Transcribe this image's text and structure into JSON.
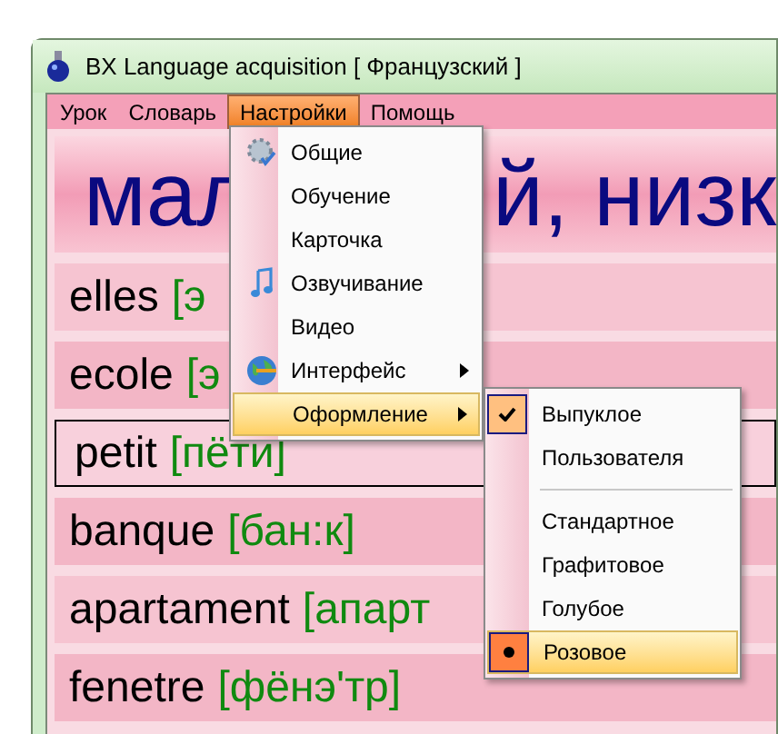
{
  "window": {
    "title": "BX Language acquisition [ Французский ]"
  },
  "menu_bar": [
    {
      "label": "Урок",
      "selected": false
    },
    {
      "label": "Словарь",
      "selected": false
    },
    {
      "label": "Настройки",
      "selected": true
    },
    {
      "label": "Помощь",
      "selected": false
    }
  ],
  "header": {
    "left": "мал",
    "right": "й, низк"
  },
  "words": [
    {
      "word": "elles",
      "transcription": "[э",
      "selected": false
    },
    {
      "word": "ecole",
      "transcription": "[э",
      "selected": false
    },
    {
      "word": "petit",
      "transcription": "[пёти]",
      "selected": true
    },
    {
      "word": "banque",
      "transcription": "[бан:к]",
      "selected": false
    },
    {
      "word": "apartament",
      "transcription": "[апарт",
      "selected": false
    },
    {
      "word": "fenetre",
      "transcription": "[фёнэ'тр]",
      "selected": false
    }
  ],
  "settings_menu": [
    {
      "label": "Общие",
      "kind": "gear",
      "submenu": false,
      "selected": false
    },
    {
      "label": "Обучение",
      "kind": "plain",
      "submenu": false,
      "selected": false
    },
    {
      "label": "Карточка",
      "kind": "plain",
      "submenu": false,
      "selected": false
    },
    {
      "label": "Озвучивание",
      "kind": "note",
      "submenu": false,
      "selected": false
    },
    {
      "label": "Видео",
      "kind": "plain",
      "submenu": false,
      "selected": false
    },
    {
      "label": "Интерфейс",
      "kind": "globe",
      "submenu": true,
      "selected": false
    },
    {
      "label": "Оформление",
      "kind": "plain",
      "submenu": true,
      "selected": true
    }
  ],
  "style_menu": {
    "groups": [
      [
        {
          "label": "Выпуклое",
          "checked": true,
          "selected": false
        },
        {
          "label": "Пользователя",
          "checked": false,
          "selected": false
        }
      ],
      [
        {
          "label": "Стандартное",
          "checked": false,
          "selected": false
        },
        {
          "label": "Графитовое",
          "checked": false,
          "selected": false
        },
        {
          "label": "Голубое",
          "checked": false,
          "selected": false
        },
        {
          "label": "Розовое",
          "checked": true,
          "selected": true
        }
      ]
    ]
  }
}
